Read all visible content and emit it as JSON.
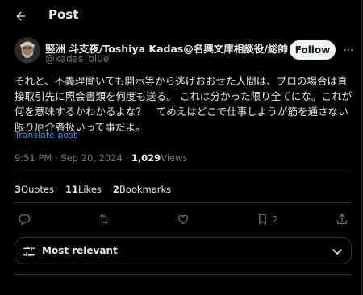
{
  "header": {
    "title": "Post"
  },
  "author": {
    "display_name": "竪洲 斗支夜/Toshiya Kadas@名興文庫相談役/総帥",
    "handle": "@kadas_blue"
  },
  "follow_label": "Follow",
  "tweet": {
    "text": "それと、不義理働いても開示等から逃げおおせた人間は、プロの場合は直\n接取引先に照会書類を何度も送る。 これは分かった限り全てにな。これが\n何を意味するかわかるよな？　てめえはどこで仕事しようが筋を通さない\n限り厄介者扱いって事だよ。",
    "translate_label": "Translate post",
    "time": "9:51 PM · Sep 20, 2024 · ",
    "views_count": "1,029",
    "views_label": "Views"
  },
  "stats": {
    "quotes_count": "3",
    "quotes_label": "Quotes",
    "likes_count": "11",
    "likes_label": "Likes",
    "bookmarks_count": "2",
    "bookmarks_label": "Bookmarks"
  },
  "actions": {
    "bookmark_count": "2"
  },
  "sort": {
    "label": "Most relevant"
  },
  "colors": {
    "accent": "#1d9bf0",
    "background": "#000000",
    "muted": "#71767b"
  }
}
